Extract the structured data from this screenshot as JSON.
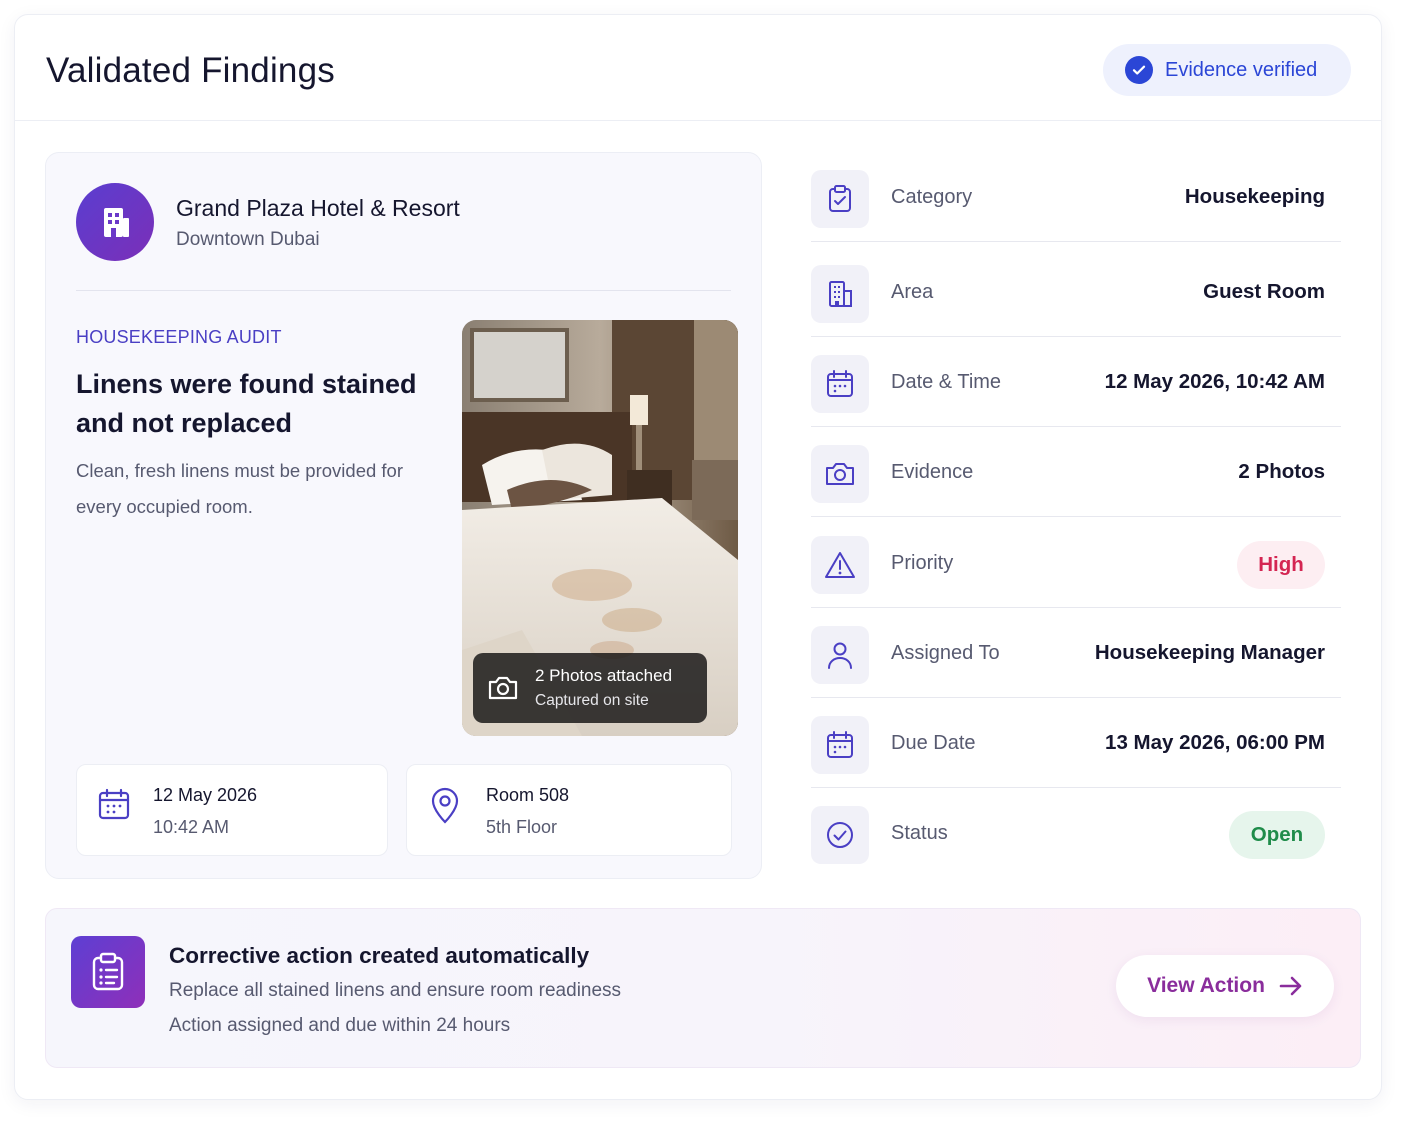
{
  "header": {
    "title": "Validated Findings",
    "verified_label": "Evidence verified"
  },
  "hotel": {
    "name": "Grand Plaza Hotel & Resort",
    "location": "Downtown Dubai"
  },
  "finding": {
    "audit_type": "HOUSEKEEPING AUDIT",
    "title": "Linens were found stained and not replaced",
    "description": "Clean, fresh linens must be provided for every occupied room."
  },
  "photo": {
    "caption_title": "2 Photos attached",
    "caption_sub": "Captured on site"
  },
  "info": {
    "date": "12 May 2026",
    "time": "10:42 AM",
    "room": "Room 508",
    "floor": "5th Floor"
  },
  "details": {
    "category": {
      "label": "Category",
      "value": "Housekeeping"
    },
    "area": {
      "label": "Area",
      "value": "Guest Room"
    },
    "datetime": {
      "label": "Date & Time",
      "value": "12 May 2026, 10:42 AM"
    },
    "evidence": {
      "label": "Evidence",
      "value": "2 Photos"
    },
    "priority": {
      "label": "Priority",
      "value": "High"
    },
    "assigned": {
      "label": "Assigned To",
      "value": "Housekeeping Manager"
    },
    "due": {
      "label": "Due Date",
      "value": "13 May 2026, 06:00 PM"
    },
    "status": {
      "label": "Status",
      "value": "Open"
    }
  },
  "action": {
    "title": "Corrective action created automatically",
    "line1": "Replace all stained linens and ensure room readiness",
    "line2": "Action assigned and due within 24 hours",
    "button_label": "View Action"
  },
  "colors": {
    "accent": "#4a3fc4",
    "verified": "#2b46d6",
    "priority_high": "#d42552",
    "status_open": "#1f8c4a",
    "action_link": "#8a2d9c"
  },
  "icons": [
    "check-circle-icon",
    "building-icon",
    "camera-icon",
    "calendar-icon",
    "location-pin-icon",
    "clipboard-icon",
    "warning-icon",
    "user-icon",
    "check-icon",
    "clipboard-list-icon",
    "arrow-right-icon"
  ]
}
